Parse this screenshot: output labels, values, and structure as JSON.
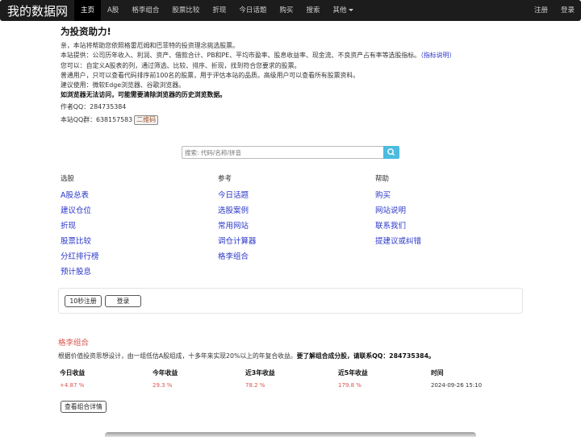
{
  "nav": {
    "brand": "我的数据网",
    "items": [
      "主页",
      "A股",
      "格李组合",
      "股票比较",
      "折现",
      "今日话题",
      "购买",
      "搜索"
    ],
    "more": "其他",
    "register": "注册",
    "login": "登录"
  },
  "intro": {
    "title": "为投资助力!",
    "l1": "亲，本站将帮助您依照格雷厄姆和巴菲特的投资理念挑选股票。",
    "l2": "本站提供：公司历年收入、利润、资产、借款合计、PB和PE、平均市盈率、股息收益率、现金流、不良资产占有率等选股指标。",
    "l2_link": "（指标说明）",
    "l3": "您可以：自定义A股表的列，通过筛选、比较、排序、折现，找到符合您要求的股票。",
    "l4": "普通用户，只可以查看代码排序前100名的股票，用于评估本站的品质。高级用户可以查看所有股票资料。",
    "l5": "建议使用：微软Edge浏览器、谷歌浏览器。",
    "l6": "如浏览器无法访问，可能需要清除浏览器的历史浏览数据。",
    "author": "作者QQ：284735384",
    "qqgroup": "本站QQ群：638157583",
    "qr": "二维码"
  },
  "search": {
    "placeholder": "搜索: 代码/名称/拼音"
  },
  "columns": {
    "pick": {
      "header": "选股",
      "links": [
        "A股总表",
        "建议仓位",
        "折现",
        "股票比较",
        "分红排行榜",
        "预计股息"
      ]
    },
    "ref": {
      "header": "参考",
      "links": [
        "今日话题",
        "选股案例",
        "常用网站",
        "调仓计算器",
        "格李组合"
      ]
    },
    "help": {
      "header": "帮助",
      "links": [
        "购买",
        "网站说明",
        "联系我们",
        "提建议或纠错"
      ]
    }
  },
  "panel": {
    "register": "10秒注册",
    "login": "登录"
  },
  "portfolio": {
    "title": "格李组合",
    "desc": "根据价值投资思想设计，由一组低估A股组成，十多年来实现20%以上的年复合收益。",
    "desc_bold": "要了解组合成分股，请联系QQ：284735384。",
    "stats": [
      {
        "label": "今日收益",
        "value": "+4.87 %"
      },
      {
        "label": "今年收益",
        "value": "29.3 %"
      },
      {
        "label": "近3年收益",
        "value": "78.2 %"
      },
      {
        "label": "近5年收益",
        "value": "179.8 %"
      },
      {
        "label": "时间",
        "value": "2024-09-26 15:10"
      }
    ],
    "detail": "查看组合详情"
  },
  "colors": {
    "navbar": "#1c1c1c",
    "link": "#2a36c9",
    "accent_red": "#d9534f",
    "brown": "#a0522d",
    "search_btn": "#4bbbe0"
  }
}
